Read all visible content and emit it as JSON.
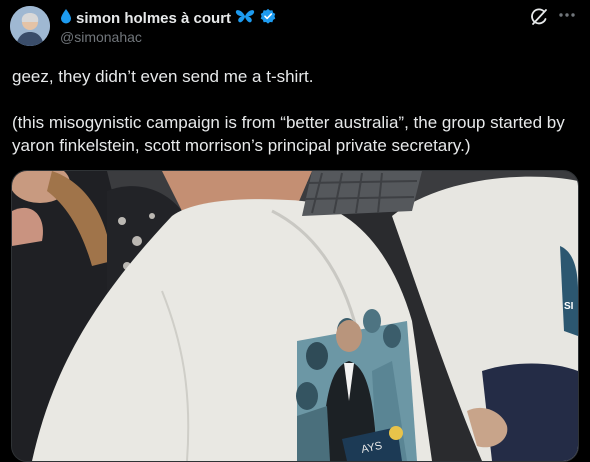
{
  "author": {
    "display_name": "simon holmes à court",
    "handle": "@simonahac",
    "verified": true
  },
  "tweet": {
    "paragraphs": [
      "geez, they didn’t even send me a t-shirt.",
      "(this misogynistic campaign is from “better australia”, the group started by yaron finkelstein, scott morrison’s principal private secretary.)"
    ]
  },
  "media": {
    "shirt_print_fragment_1": "SI",
    "shirt_print_fragment_2": "AYS"
  },
  "icons": {
    "name_prefix": "water-drop-icon",
    "name_suffix": "butterfly-icon",
    "verified": "verified-badge-icon",
    "grok": "grok-icon",
    "more": "more-options-icon"
  },
  "colors": {
    "background": "#000000",
    "text_primary": "#e7e9ea",
    "text_secondary": "#71767b",
    "accent_blue": "#1d9bf0"
  }
}
